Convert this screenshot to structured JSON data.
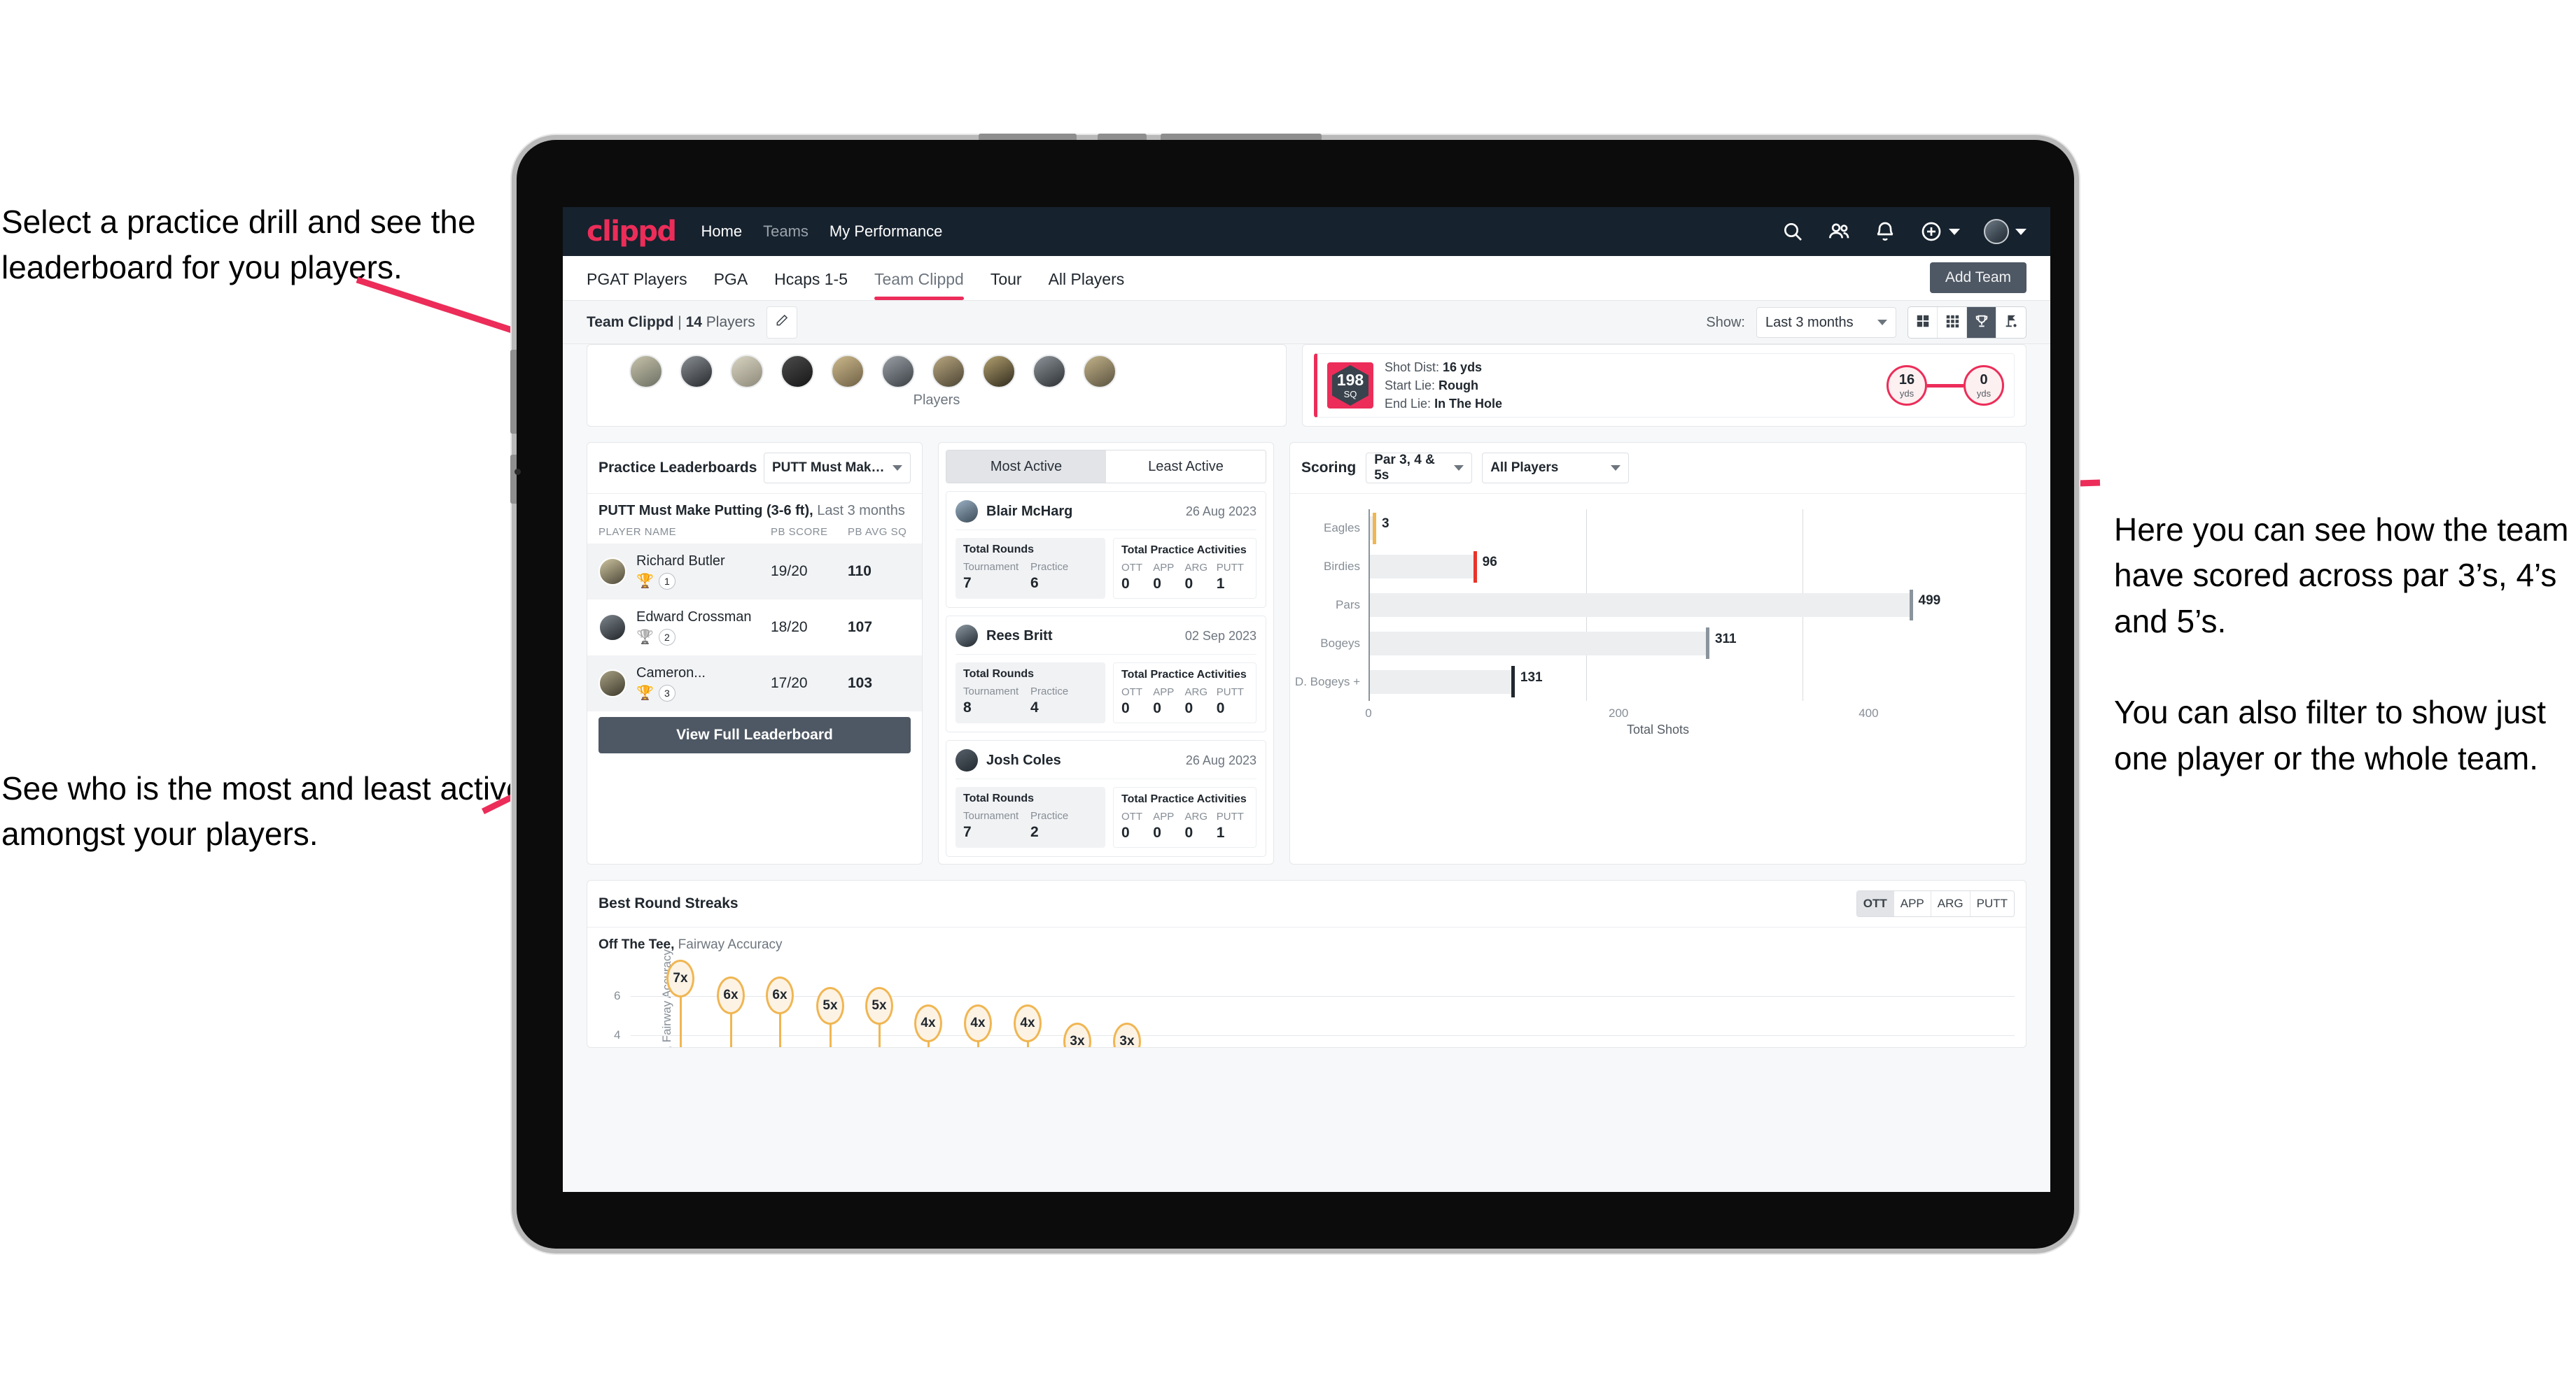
{
  "annotations": {
    "top_left": "Select a practice drill and see the leaderboard for you players.",
    "bottom_left": "See who is the most and least active amongst your players.",
    "right": "Here you can see how the team have scored across par 3’s, 4’s and 5’s.\n\nYou can also filter to show just one player or the whole team."
  },
  "colors": {
    "brand_pink": "#ec2d59",
    "header_navy": "#16222e",
    "slate": "#4e5864",
    "amber": "#f0b653"
  },
  "appbar": {
    "logo": "clippd",
    "nav": [
      {
        "label": "Home",
        "active": true
      },
      {
        "label": "Teams",
        "active": false
      },
      {
        "label": "My Performance",
        "active": true
      }
    ],
    "icons": [
      "search-icon",
      "people-icon",
      "bell-icon",
      "plus-circle-icon",
      "avatar-icon"
    ]
  },
  "tabs": [
    {
      "label": "PGAT Players",
      "active": false
    },
    {
      "label": "PGA",
      "active": false
    },
    {
      "label": "Hcaps 1-5",
      "active": false
    },
    {
      "label": "Team Clippd",
      "active": true
    },
    {
      "label": "Tour",
      "active": false
    },
    {
      "label": "All Players",
      "active": false
    }
  ],
  "add_team_button": "Add Team",
  "subheader": {
    "team_name": "Team Clippd",
    "separator": " | ",
    "player_count": "14",
    "players_word": " Players",
    "edit_icon": "pencil-icon"
  },
  "toolbar": {
    "show_label": "Show:",
    "range_value": "Last 3 months",
    "views": [
      {
        "icon": "grid-large-icon",
        "active": false
      },
      {
        "icon": "grid-small-icon",
        "active": false
      },
      {
        "icon": "trophy-icon",
        "active": true
      },
      {
        "icon": "golf-flag-icon",
        "active": false
      }
    ]
  },
  "players_card": {
    "caption": "Players",
    "avatar_count": 10
  },
  "shot_card": {
    "sq_value": "198",
    "sq_unit": "SQ",
    "lines": [
      {
        "label": "Shot Dist: ",
        "value": "16 yds"
      },
      {
        "label": "Start Lie: ",
        "value": "Rough"
      },
      {
        "label": "End Lie: ",
        "value": "In The Hole"
      }
    ],
    "start_circle": {
      "value": "16",
      "unit": "yds"
    },
    "end_circle": {
      "value": "0",
      "unit": "yds"
    }
  },
  "leaderboard": {
    "title": "Practice Leaderboards",
    "drill_select": "PUTT Must Make Putting ...",
    "subtitle_bold": "PUTT Must Make Putting (3-6 ft),",
    "subtitle_soft": " Last 3 months",
    "columns": [
      "PLAYER NAME",
      "PB SCORE",
      "PB AVG SQ"
    ],
    "rows": [
      {
        "name": "Richard Butler",
        "rank": "1",
        "trophy": "gold",
        "score": "19/20",
        "sq": "110"
      },
      {
        "name": "Edward Crossman",
        "rank": "2",
        "trophy": "silver",
        "score": "18/20",
        "sq": "107"
      },
      {
        "name": "Cameron...",
        "rank": "3",
        "trophy": "bronze",
        "score": "17/20",
        "sq": "103"
      }
    ],
    "button": "View Full Leaderboard"
  },
  "activity": {
    "tabs": [
      {
        "label": "Most Active",
        "active": true
      },
      {
        "label": "Least Active",
        "active": false
      }
    ],
    "rounds_title": "Total Rounds",
    "rounds_keys": [
      "Tournament",
      "Practice"
    ],
    "activities_title": "Total Practice Activities",
    "activities_keys": [
      "OTT",
      "APP",
      "ARG",
      "PUTT"
    ],
    "players": [
      {
        "name": "Blair McHarg",
        "date": "26 Aug 2023",
        "rounds": [
          "7",
          "6"
        ],
        "activities": [
          "0",
          "0",
          "0",
          "1"
        ]
      },
      {
        "name": "Rees Britt",
        "date": "02 Sep 2023",
        "rounds": [
          "8",
          "4"
        ],
        "activities": [
          "0",
          "0",
          "0",
          "0"
        ]
      },
      {
        "name": "Josh Coles",
        "date": "26 Aug 2023",
        "rounds": [
          "7",
          "2"
        ],
        "activities": [
          "0",
          "0",
          "0",
          "1"
        ]
      }
    ]
  },
  "scoring": {
    "title": "Scoring",
    "par_select": "Par 3, 4 & 5s",
    "player_select": "All Players"
  },
  "chart_data": {
    "type": "bar",
    "orientation": "horizontal",
    "title": "Scoring",
    "categories": [
      "Eagles",
      "Birdies",
      "Pars",
      "Bogeys",
      "D. Bogeys +"
    ],
    "values": [
      3,
      96,
      499,
      311,
      131
    ],
    "cap_colors": [
      "#f0b653",
      "#e8342a",
      "#8b949c",
      "#8b949c",
      "#20272e"
    ],
    "xlabel": "Total Shots",
    "ylabel": "",
    "xlim": [
      0,
      540
    ],
    "xticks": [
      0,
      200,
      400
    ],
    "grid": true,
    "legend": "none"
  },
  "streaks": {
    "title": "Best Round Streaks",
    "toggle": [
      {
        "label": "OTT",
        "active": true
      },
      {
        "label": "APP",
        "active": false
      },
      {
        "label": "ARG",
        "active": false
      },
      {
        "label": "PUTT",
        "active": false
      }
    ],
    "subtitle_bold": "Off The Tee,",
    "subtitle_soft": " Fairway Accuracy",
    "axis_label": "Streak, Fairway Accuracy",
    "yticks": [
      "6",
      "4"
    ],
    "values": [
      "7x",
      "6x",
      "6x",
      "5x",
      "5x",
      "4x",
      "4x",
      "4x",
      "3x",
      "3x"
    ]
  }
}
